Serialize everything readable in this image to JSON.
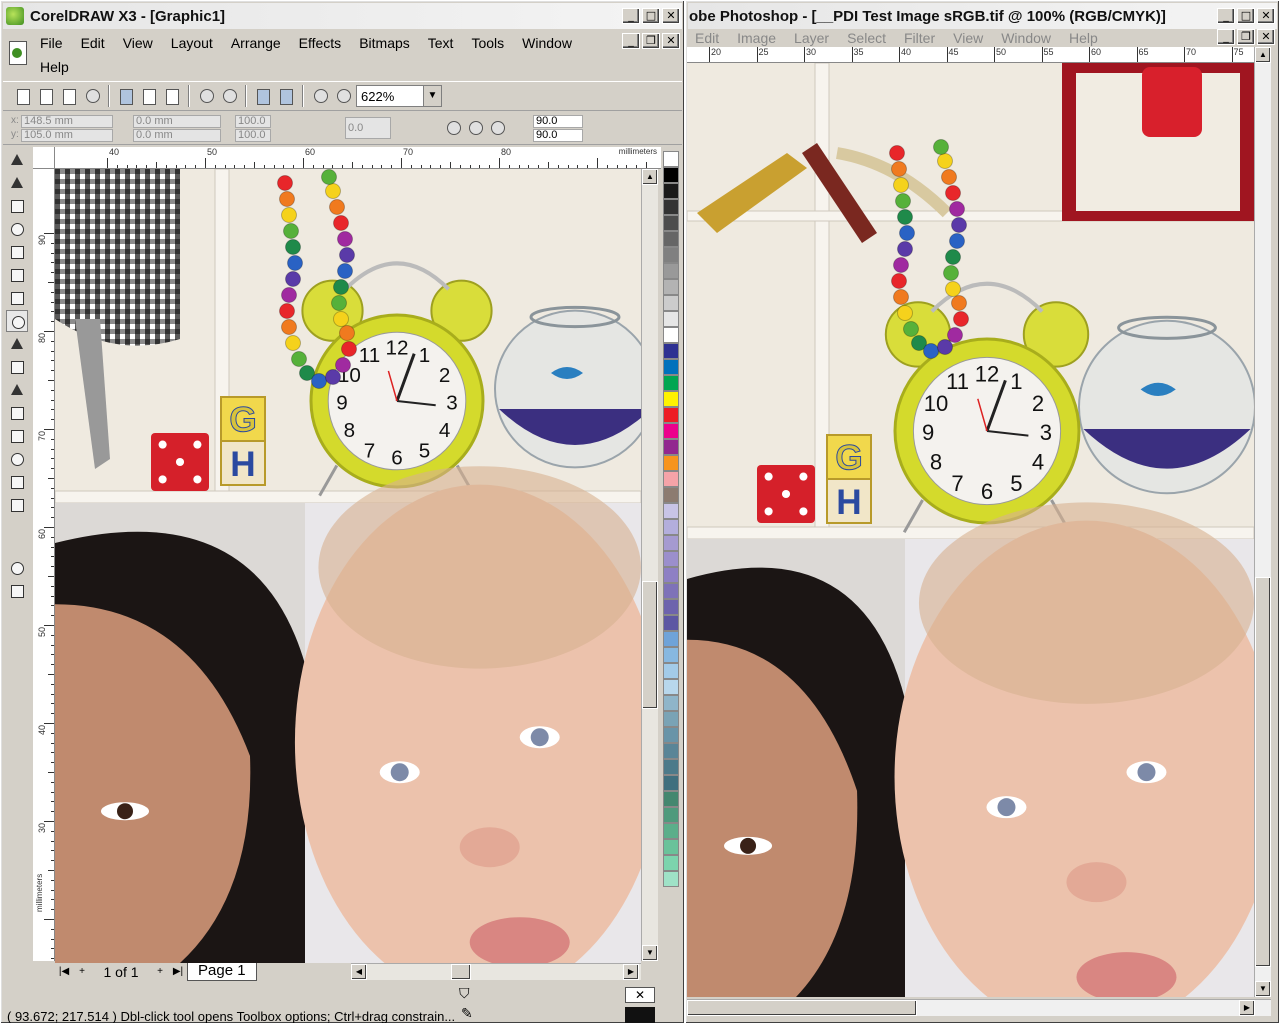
{
  "corel": {
    "title": "CorelDRAW X3 - [Graphic1]",
    "menu": [
      "File",
      "Edit",
      "View",
      "Layout",
      "Arrange",
      "Effects",
      "Bitmaps",
      "Text",
      "Tools",
      "Window",
      "Help"
    ],
    "zoom": "622%",
    "props": {
      "x": "148.5 mm",
      "y": "105.0 mm",
      "w": "0.0 mm",
      "h": "0.0 mm",
      "sx": "100.0",
      "sy": "100.0",
      "rot": "0.0",
      "angle1": "90.0",
      "angle2": "90.0"
    },
    "ruler_unit": "millimeters",
    "hruler_labels": [
      "40",
      "50",
      "60",
      "70",
      "80"
    ],
    "vruler_labels": [
      "90",
      "80",
      "70",
      "60",
      "50",
      "40",
      "30"
    ],
    "page_info": "1 of 1",
    "page_tab": "Page 1",
    "status": "( 93.672; 217.514 )  Dbl-click tool opens Toolbox options; Ctrl+drag constrain...",
    "palette": [
      "#ffffff",
      "#000000",
      "#1a1a1a",
      "#333333",
      "#4d4d4d",
      "#666666",
      "#808080",
      "#999999",
      "#b3b3b3",
      "#cccccc",
      "#e6e6e6",
      "#ffffff",
      "#2e3192",
      "#0071bc",
      "#00a651",
      "#fff200",
      "#ed1c24",
      "#ec008c",
      "#92278f",
      "#f7941d",
      "#f5a3a8",
      "#8c7b70",
      "#c8c4e6",
      "#b3aedc",
      "#a59ad0",
      "#9b8fcc",
      "#8e80c4",
      "#7e72b8",
      "#6d63ad",
      "#5d57a3",
      "#6fa3d8",
      "#87b8e0",
      "#a3cbe8",
      "#b8d7ec",
      "#8fb5c9",
      "#7aa3b5",
      "#6994a8",
      "#5a8597",
      "#4c7a8a",
      "#3f6f7e",
      "#44876f",
      "#4f9a7c",
      "#5bae8a",
      "#6ac29a",
      "#7cd4ad",
      "#9fe2c7"
    ]
  },
  "ps": {
    "title": "obe Photoshop - [__PDI Test Image sRGB.tif @ 100% (RGB/CMYK)]",
    "menu": [
      "Edit",
      "Image",
      "Layer",
      "Select",
      "Filter",
      "View",
      "Window",
      "Help"
    ],
    "ruler_labels": [
      "20",
      "25",
      "30",
      "35",
      "40",
      "45",
      "50",
      "55",
      "60",
      "65",
      "70",
      "75"
    ]
  },
  "photo": {
    "clock_numbers": [
      "12",
      "1",
      "2",
      "3",
      "4",
      "5",
      "6",
      "7",
      "8",
      "9",
      "10",
      "11"
    ],
    "blocks": [
      "G",
      "H"
    ]
  }
}
